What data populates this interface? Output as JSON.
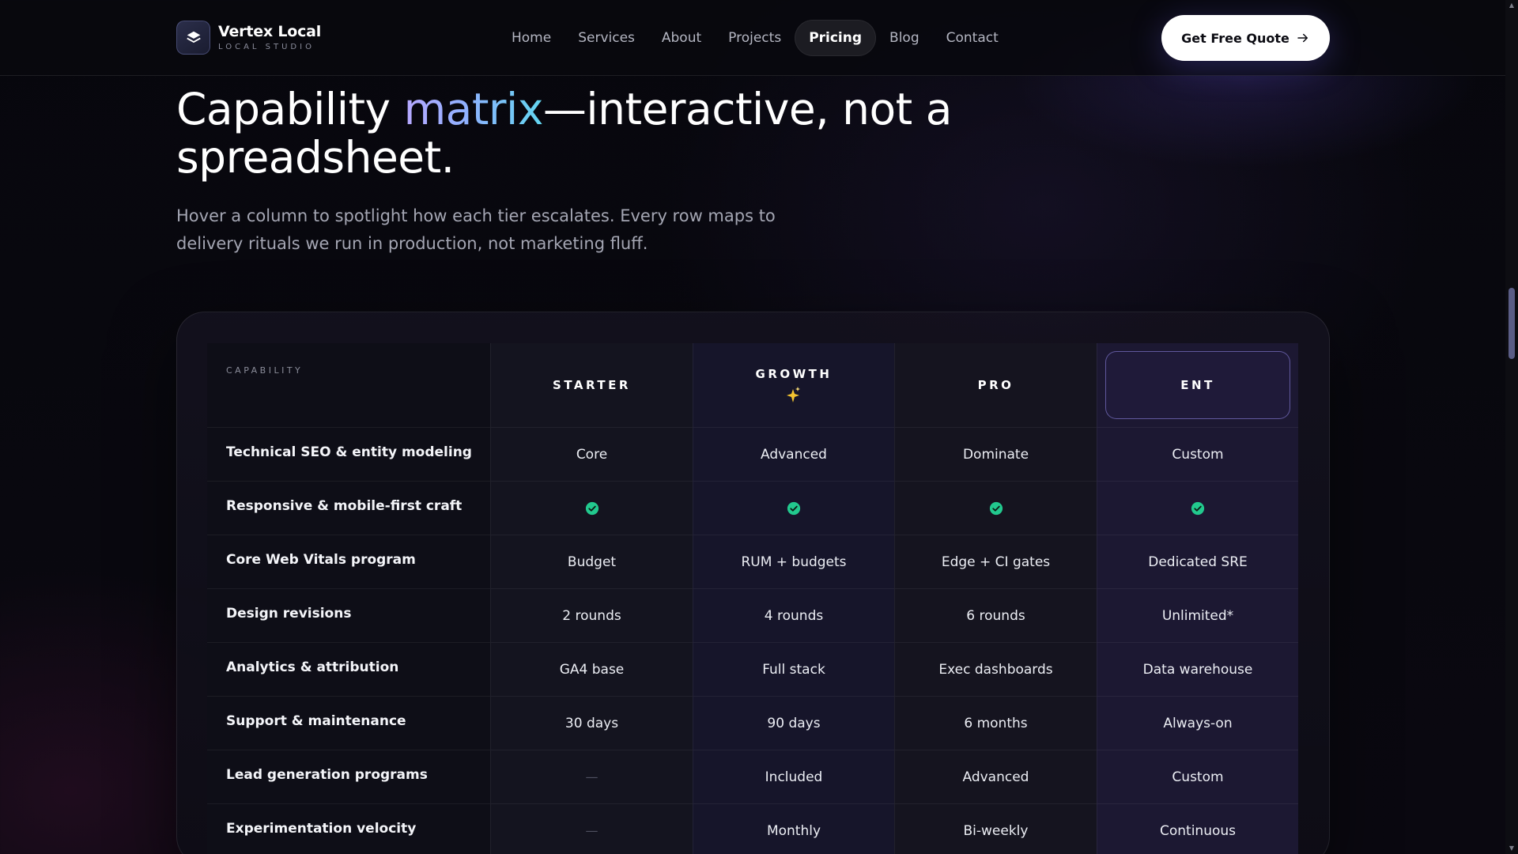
{
  "brand": {
    "name": "Vertex Local",
    "subtitle": "LOCAL STUDIO",
    "logo_icon": "layers-icon"
  },
  "nav": {
    "items": [
      {
        "label": "Home",
        "active": false
      },
      {
        "label": "Services",
        "active": false
      },
      {
        "label": "About",
        "active": false
      },
      {
        "label": "Projects",
        "active": false
      },
      {
        "label": "Pricing",
        "active": true
      },
      {
        "label": "Blog",
        "active": false
      },
      {
        "label": "Contact",
        "active": false
      }
    ],
    "cta": {
      "label": "Get Free Quote",
      "icon": "arrow-right-icon"
    }
  },
  "hero": {
    "title_part1": "Capability ",
    "title_accent": "matrix",
    "title_part2": "—interactive, not a spreadsheet.",
    "subtitle": "Hover a column to spotlight how each tier escalates. Every row maps to delivery rituals we run in production, not marketing fluff."
  },
  "matrix": {
    "header_label": "CAPABILITY",
    "tiers": [
      "STARTER",
      "GROWTH",
      "PRO",
      "ENT"
    ],
    "featured_icon": "sparkle-icon",
    "rows": [
      {
        "label": "Technical SEO & entity modeling",
        "values": [
          "Core",
          "Advanced",
          "Dominate",
          "Custom"
        ]
      },
      {
        "label": "Responsive & mobile-first craft",
        "values": [
          "✓",
          "✓",
          "✓",
          "✓"
        ]
      },
      {
        "label": "Core Web Vitals program",
        "values": [
          "Budget",
          "RUM + budgets",
          "Edge + CI gates",
          "Dedicated SRE"
        ]
      },
      {
        "label": "Design revisions",
        "values": [
          "2 rounds",
          "4 rounds",
          "6 rounds",
          "Unlimited*"
        ]
      },
      {
        "label": "Analytics & attribution",
        "values": [
          "GA4 base",
          "Full stack",
          "Exec dashboards",
          "Data warehouse"
        ]
      },
      {
        "label": "Support & maintenance",
        "values": [
          "30 days",
          "90 days",
          "6 months",
          "Always-on"
        ]
      },
      {
        "label": "Lead generation programs",
        "values": [
          "—",
          "Included",
          "Advanced",
          "Custom"
        ]
      },
      {
        "label": "Experimentation velocity",
        "values": [
          "—",
          "Monthly",
          "Bi-weekly",
          "Continuous"
        ]
      }
    ]
  },
  "colors": {
    "accent": "#8fb1ff",
    "check": "#22c98e",
    "ent_border": "#968cf0"
  }
}
